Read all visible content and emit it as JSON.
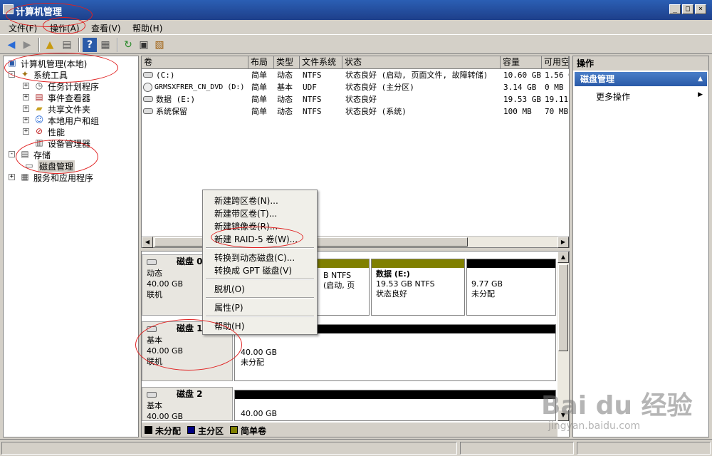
{
  "window": {
    "title": "计算机管理"
  },
  "menu": [
    "文件(F)",
    "操作(A)",
    "查看(V)",
    "帮助(H)"
  ],
  "tree": {
    "root": "计算机管理(本地)",
    "system_tools": "系统工具",
    "task_scheduler": "任务计划程序",
    "event_viewer": "事件查看器",
    "shared_folders": "共享文件夹",
    "local_users": "本地用户和组",
    "performance": "性能",
    "device_manager": "设备管理器",
    "storage": "存储",
    "disk_management": "磁盘管理",
    "services_apps": "服务和应用程序"
  },
  "volumes": {
    "columns": [
      "卷",
      "布局",
      "类型",
      "文件系统",
      "状态",
      "容量",
      "可用空"
    ],
    "rows": [
      [
        "(C:)",
        "简单",
        "动态",
        "NTFS",
        "状态良好 (启动, 页面文件, 故障转储)",
        "10.60 GB",
        "1.56 G"
      ],
      [
        "GRMSXFRER_CN_DVD (D:)",
        "简单",
        "基本",
        "UDF",
        "状态良好 (主分区)",
        "3.14 GB",
        "0 MB"
      ],
      [
        "数据 (E:)",
        "简单",
        "动态",
        "NTFS",
        "状态良好",
        "19.53 GB",
        "19.11"
      ],
      [
        "系统保留",
        "简单",
        "动态",
        "NTFS",
        "状态良好 (系统)",
        "100 MB",
        "70 MB"
      ]
    ]
  },
  "disks": {
    "disk0": {
      "name": "磁盘 0",
      "type": "动态",
      "size": "40.00 GB",
      "status": "联机"
    },
    "disk1": {
      "name": "磁盘 1",
      "type": "基本",
      "size": "40.00 GB",
      "status": "联机"
    },
    "disk2": {
      "name": "磁盘 2",
      "type": "基本",
      "size": "40.00 GB"
    },
    "d0_part_c": {
      "line1": "B NTFS",
      "line2": "(启动, 页"
    },
    "d0_part_e": {
      "title": "数据 (E:)",
      "line1": "19.53 GB NTFS",
      "line2": "状态良好"
    },
    "d0_part_free": {
      "line1": "9.77 GB",
      "line2": "未分配"
    },
    "d1_part": {
      "line1": "40.00 GB",
      "line2": "未分配"
    },
    "d2_part": {
      "line1": "40.00 GB"
    }
  },
  "legend": [
    "未分配",
    "主分区",
    "简单卷"
  ],
  "colors": {
    "unallocated": "#000000",
    "primary": "#000080",
    "simple": "#808000"
  },
  "actions": {
    "header": "操作",
    "selected": "磁盘管理",
    "more": "更多操作"
  },
  "context_menu": {
    "spanned": "新建跨区卷(N)...",
    "striped": "新建带区卷(T)...",
    "mirrored": "新建镜像卷(R)...",
    "raid5": "新建 RAID-5 卷(W)...",
    "to_dynamic": "转换到动态磁盘(C)...",
    "to_gpt": "转换成 GPT 磁盘(V)",
    "offline": "脱机(O)",
    "properties": "属性(P)",
    "help": "帮助(H)"
  },
  "watermark": {
    "brand": "Bai du 经验",
    "url": "jingyan.baidu.com"
  }
}
